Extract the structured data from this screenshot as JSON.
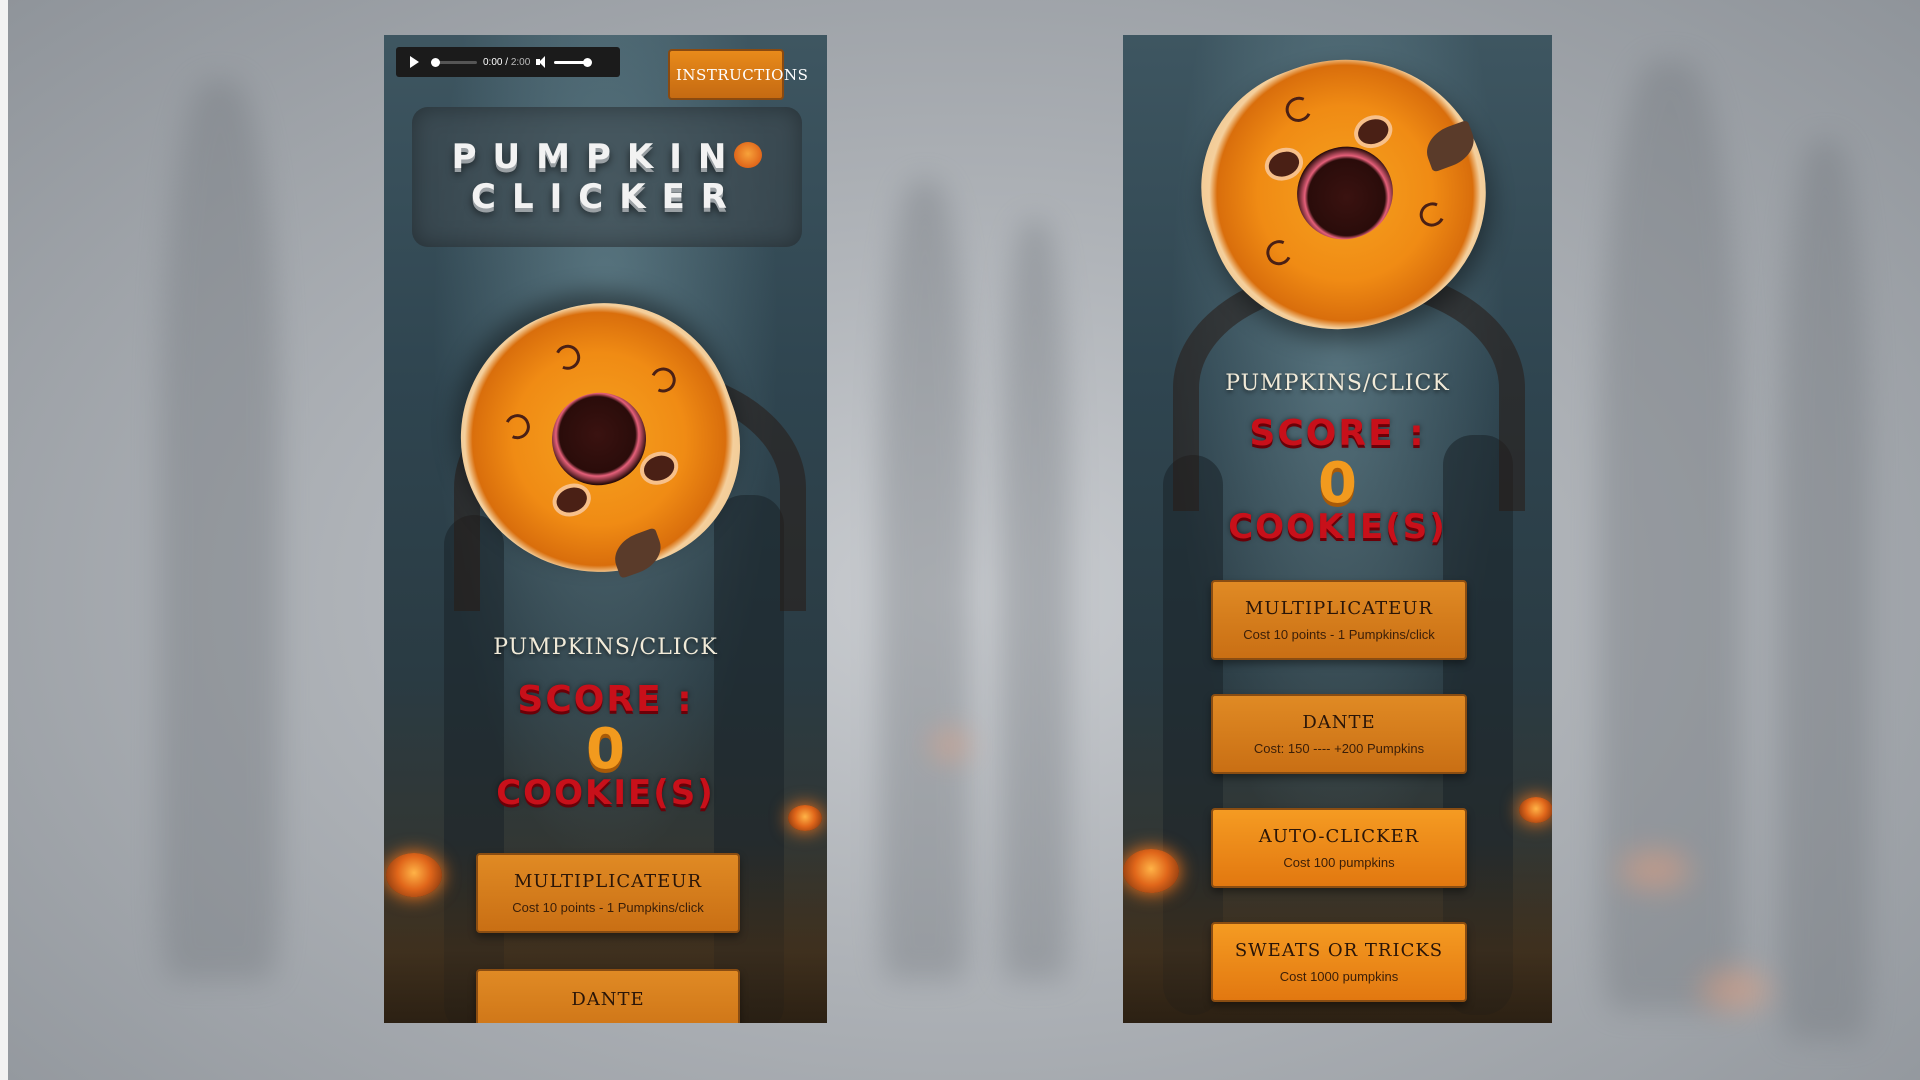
{
  "audio": {
    "current_time": "0:00",
    "duration": "2:00",
    "progress": 0.0,
    "volume": 1.0
  },
  "header": {
    "instructions_label": "INSTRUCTIONS"
  },
  "title": {
    "line1": "PUMPKIN",
    "line2": "CLICKER"
  },
  "stats": {
    "per_click_label": "PUMPKINS/CLICK",
    "score_label": "SCORE :",
    "score_value": "0",
    "score_unit": "COOKIE(S)"
  },
  "shop": [
    {
      "title": "MULTIPLICATEUR",
      "desc": "Cost 10 points - 1 Pumpkins/click"
    },
    {
      "title": "DANTE",
      "desc": "Cost: 150 ---- +200 Pumpkins"
    },
    {
      "title": "AUTO-CLICKER",
      "desc": "Cost 100 pumpkins"
    },
    {
      "title": "SWEATS OR TRICKS",
      "desc": "Cost 1000 pumpkins"
    }
  ],
  "colors": {
    "accent": "#e08a24",
    "score_red": "#c8101a",
    "score_orange": "#f29a1e"
  },
  "icons": [
    "play-icon",
    "volume-icon",
    "pumpkin-emoji-icon",
    "pumpkin-cookie"
  ]
}
